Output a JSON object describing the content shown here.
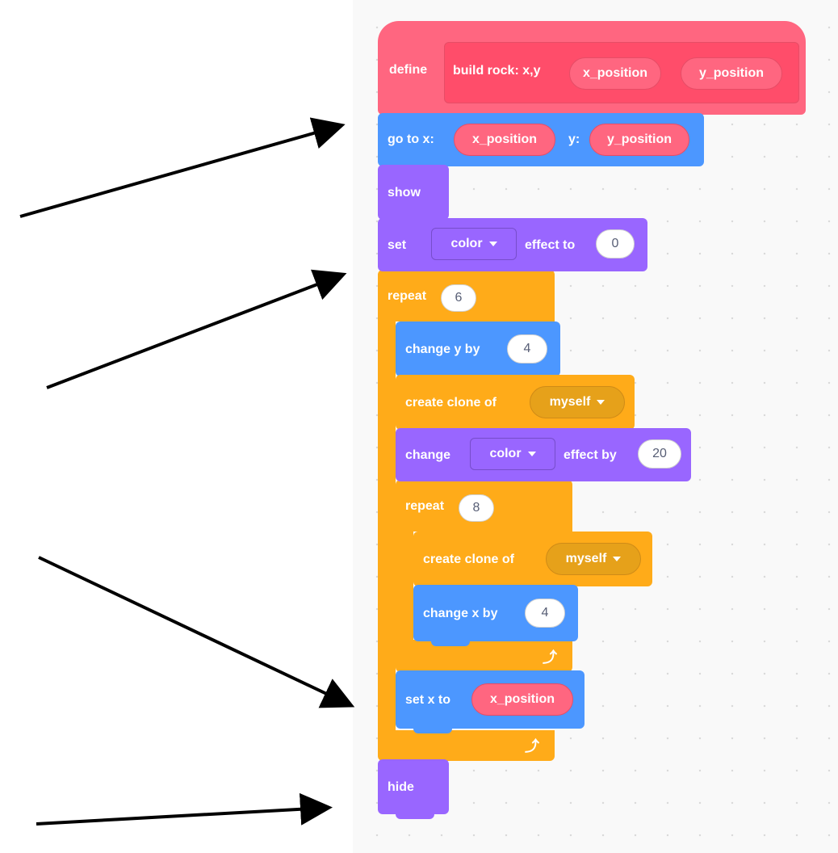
{
  "define_block": {
    "define_label": "define",
    "proc_name": "build rock: x,y",
    "param1": "x_position",
    "param2": "y_position"
  },
  "go_to": {
    "label": "go to x:",
    "x": "x_position",
    "y_label": "y:",
    "y": "y_position"
  },
  "show": {
    "label": "show"
  },
  "set_effect": {
    "label": "set",
    "effect": "color",
    "to_label": "effect to",
    "value": "0"
  },
  "repeat_outer": {
    "label": "repeat",
    "count": "6"
  },
  "change_y": {
    "label": "change y by",
    "value": "4"
  },
  "clone1": {
    "label": "create clone of",
    "target": "myself"
  },
  "change_effect": {
    "label": "change",
    "effect": "color",
    "by_label": "effect by",
    "value": "20"
  },
  "repeat_inner": {
    "label": "repeat",
    "count": "8"
  },
  "clone2": {
    "label": "create clone of",
    "target": "myself"
  },
  "change_x": {
    "label": "change x by",
    "value": "4"
  },
  "set_x": {
    "label": "set x to",
    "value": "x_position"
  },
  "hide": {
    "label": "hide"
  },
  "colors": {
    "my_blocks": "#ff6680",
    "motion": "#4c97ff",
    "looks": "#9966ff",
    "control": "#ffab19",
    "workspace": "#f9f9f9",
    "arrow": "#000000"
  }
}
